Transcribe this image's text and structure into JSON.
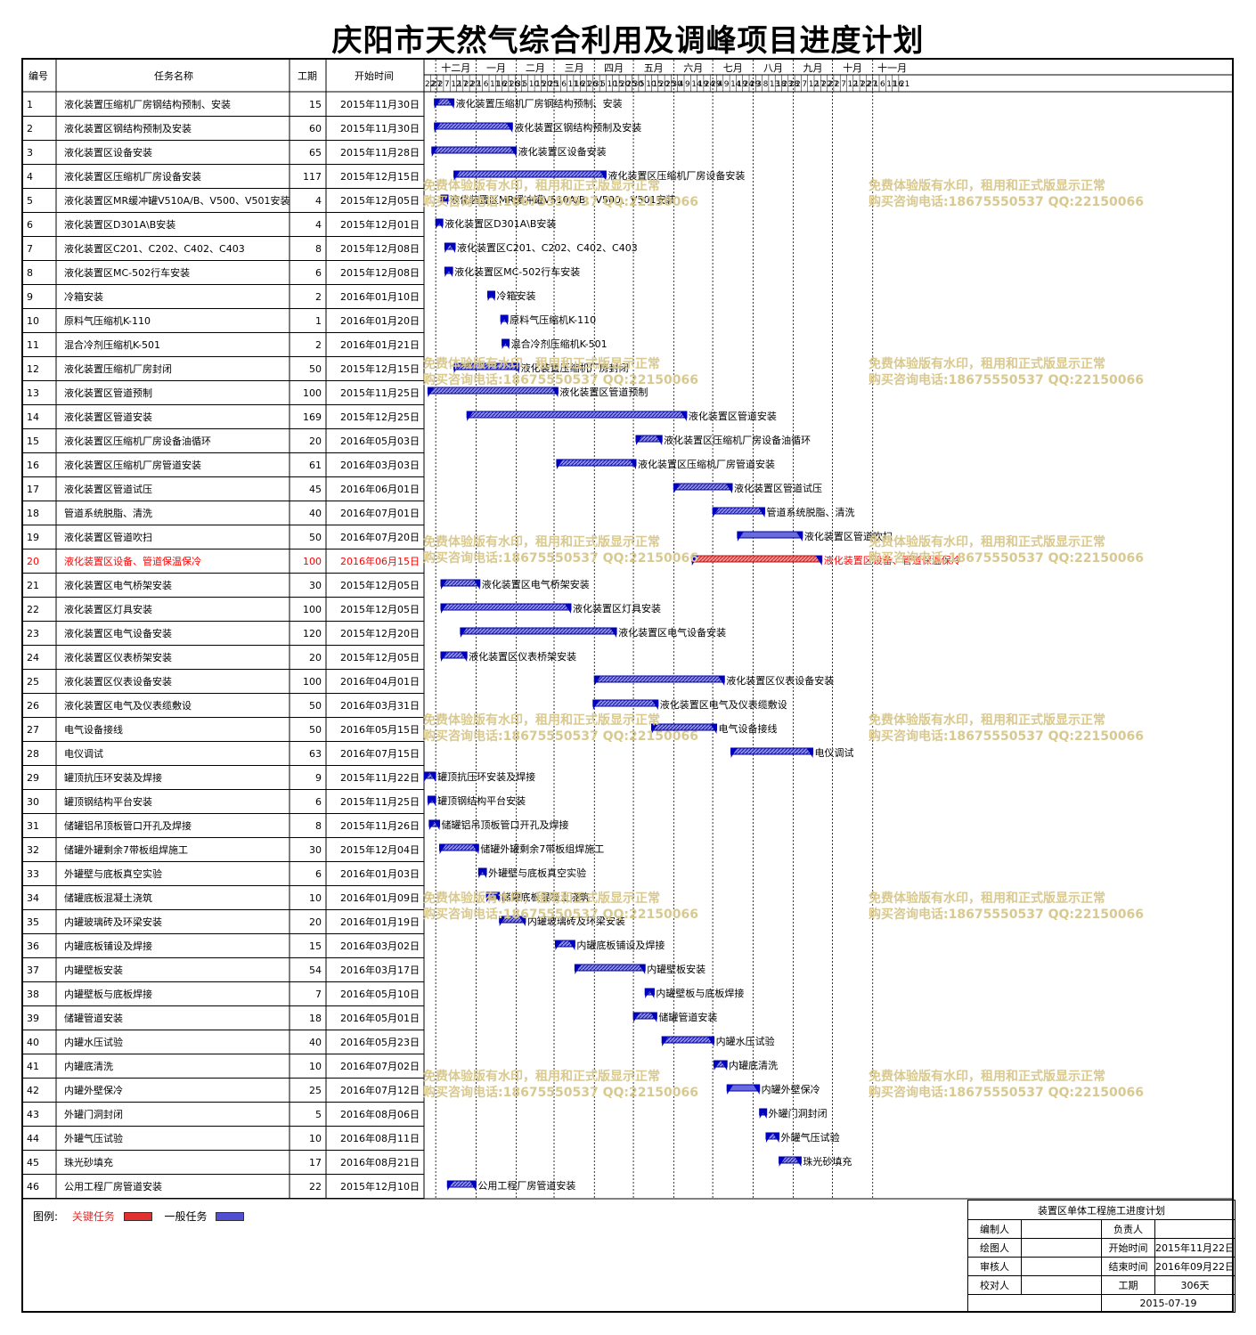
{
  "title": "庆阳市天然气综合利用及调峰项目进度计划",
  "headers": {
    "id": "编号",
    "name": "任务名称",
    "duration": "工期",
    "start": "开始时间"
  },
  "months": [
    "十二月",
    "一月",
    "二月",
    "三月",
    "四月",
    "五月",
    "六月",
    "七月",
    "八月",
    "九月",
    "十月",
    "十一月"
  ],
  "colors": {
    "critical": "#e03030",
    "normal": "#1010d0",
    "text_critical": "#ff0000"
  },
  "chart_data": {
    "type": "gantt",
    "timeline_start": "2015-11-22",
    "tasks": [
      {
        "id": "1",
        "name": "液化装置压缩机厂房钢结构预制、安装",
        "duration": 15,
        "start": "2015年11月30日",
        "start_date": "2015-11-30"
      },
      {
        "id": "2",
        "name": "液化装置区钢结构预制及安装",
        "duration": 60,
        "start": "2015年11月30日",
        "start_date": "2015-11-30"
      },
      {
        "id": "3",
        "name": "液化装置区设备安装",
        "duration": 65,
        "start": "2015年11月28日",
        "start_date": "2015-11-28"
      },
      {
        "id": "4",
        "name": "液化装置区压缩机厂房设备安装",
        "duration": 117,
        "start": "2015年12月15日",
        "start_date": "2015-12-15"
      },
      {
        "id": "5",
        "name": "液化装置区MR缓冲罐V510A/B、V500、V501安装",
        "duration": 4,
        "start": "2015年12月05日",
        "start_date": "2015-12-05"
      },
      {
        "id": "6",
        "name": "液化装置区D301A\\B安装",
        "duration": 4,
        "start": "2015年12月01日",
        "start_date": "2015-12-01"
      },
      {
        "id": "7",
        "name": "液化装置区C201、C202、C402、C403",
        "duration": 8,
        "start": "2015年12月08日",
        "start_date": "2015-12-08"
      },
      {
        "id": "8",
        "name": "液化装置区MC-502行车安装",
        "duration": 6,
        "start": "2015年12月08日",
        "start_date": "2015-12-08"
      },
      {
        "id": "9",
        "name": "冷箱安装",
        "duration": 2,
        "start": "2016年01月10日",
        "start_date": "2016-01-10"
      },
      {
        "id": "10",
        "name": "原料气压缩机K-110",
        "duration": 1,
        "start": "2016年01月20日",
        "start_date": "2016-01-20"
      },
      {
        "id": "11",
        "name": "混合冷剂压缩机K-501",
        "duration": 2,
        "start": "2016年01月21日",
        "start_date": "2016-01-21"
      },
      {
        "id": "12",
        "name": "液化装置压缩机厂房封闭",
        "duration": 50,
        "start": "2015年12月15日",
        "start_date": "2015-12-15"
      },
      {
        "id": "13",
        "name": "液化装置区管道预制",
        "duration": 100,
        "start": "2015年11月25日",
        "start_date": "2015-11-25"
      },
      {
        "id": "14",
        "name": "液化装置区管道安装",
        "duration": 169,
        "start": "2015年12月25日",
        "start_date": "2015-12-25"
      },
      {
        "id": "15",
        "name": "液化装置区压缩机厂房设备油循环",
        "duration": 20,
        "start": "2016年05月03日",
        "start_date": "2016-05-03"
      },
      {
        "id": "16",
        "name": "液化装置区压缩机厂房管道安装",
        "duration": 61,
        "start": "2016年03月03日",
        "start_date": "2016-03-03"
      },
      {
        "id": "17",
        "name": "液化装置区管道试压",
        "duration": 45,
        "start": "2016年06月01日",
        "start_date": "2016-06-01"
      },
      {
        "id": "18",
        "name": "管道系统脱脂、清洗",
        "duration": 40,
        "start": "2016年07月01日",
        "start_date": "2016-07-01"
      },
      {
        "id": "19",
        "name": "液化装置区管道吹扫",
        "duration": 50,
        "start": "2016年07月20日",
        "start_date": "2016-07-20",
        "style": "plain"
      },
      {
        "id": "20",
        "name": "液化装置区设备、管道保温保冷",
        "duration": 100,
        "start": "2016年06月15日",
        "start_date": "2016-06-15",
        "critical": true
      },
      {
        "id": "21",
        "name": "液化装置区电气桥架安装",
        "duration": 30,
        "start": "2015年12月05日",
        "start_date": "2015-12-05"
      },
      {
        "id": "22",
        "name": "液化装置区灯具安装",
        "duration": 100,
        "start": "2015年12月05日",
        "start_date": "2015-12-05"
      },
      {
        "id": "23",
        "name": "液化装置区电气设备安装",
        "duration": 120,
        "start": "2015年12月20日",
        "start_date": "2015-12-20"
      },
      {
        "id": "24",
        "name": "液化装置区仪表桥架安装",
        "duration": 20,
        "start": "2015年12月05日",
        "start_date": "2015-12-05"
      },
      {
        "id": "25",
        "name": "液化装置区仪表设备安装",
        "duration": 100,
        "start": "2016年04月01日",
        "start_date": "2016-04-01"
      },
      {
        "id": "26",
        "name": "液化装置区电气及仪表缆敷设",
        "duration": 50,
        "start": "2016年03月31日",
        "start_date": "2016-03-31"
      },
      {
        "id": "27",
        "name": "电气设备接线",
        "duration": 50,
        "start": "2016年05月15日",
        "start_date": "2016-05-15"
      },
      {
        "id": "28",
        "name": "电仪调试",
        "duration": 63,
        "start": "2016年07月15日",
        "start_date": "2016-07-15"
      },
      {
        "id": "29",
        "name": "罐顶抗压环安装及焊接",
        "duration": 9,
        "start": "2015年11月22日",
        "start_date": "2015-11-22"
      },
      {
        "id": "30",
        "name": "罐顶钢结构平台安装",
        "duration": 6,
        "start": "2015年11月25日",
        "start_date": "2015-11-25"
      },
      {
        "id": "31",
        "name": "储罐铝吊顶板管口开孔及焊接",
        "duration": 8,
        "start": "2015年11月26日",
        "start_date": "2015-11-26"
      },
      {
        "id": "32",
        "name": "储罐外罐剩余7带板组焊施工",
        "duration": 30,
        "start": "2015年12月04日",
        "start_date": "2015-12-04"
      },
      {
        "id": "33",
        "name": "外罐壁与底板真空实验",
        "duration": 6,
        "start": "2016年01月03日",
        "start_date": "2016-01-03"
      },
      {
        "id": "34",
        "name": "储罐底板混凝土浇筑",
        "duration": 10,
        "start": "2016年01月09日",
        "start_date": "2016-01-09"
      },
      {
        "id": "35",
        "name": "内罐玻璃砖及环梁安装",
        "duration": 20,
        "start": "2016年01月19日",
        "start_date": "2016-01-19"
      },
      {
        "id": "36",
        "name": "内罐底板铺设及焊接",
        "duration": 15,
        "start": "2016年03月02日",
        "start_date": "2016-03-02"
      },
      {
        "id": "37",
        "name": "内罐壁板安装",
        "duration": 54,
        "start": "2016年03月17日",
        "start_date": "2016-03-17"
      },
      {
        "id": "38",
        "name": "内罐壁板与底板焊接",
        "duration": 7,
        "start": "2016年05月10日",
        "start_date": "2016-05-10"
      },
      {
        "id": "39",
        "name": "储罐管道安装",
        "duration": 18,
        "start": "2016年05月01日",
        "start_date": "2016-05-01"
      },
      {
        "id": "40",
        "name": "内罐水压试验",
        "duration": 40,
        "start": "2016年05月23日",
        "start_date": "2016-05-23"
      },
      {
        "id": "41",
        "name": "内罐底清洗",
        "duration": 10,
        "start": "2016年07月02日",
        "start_date": "2016-07-02"
      },
      {
        "id": "42",
        "name": "内罐外壁保冷",
        "duration": 25,
        "start": "2016年07月12日",
        "start_date": "2016-07-12",
        "style": "plain"
      },
      {
        "id": "43",
        "name": "外罐门洞封闭",
        "duration": 5,
        "start": "2016年08月06日",
        "start_date": "2016-08-06"
      },
      {
        "id": "44",
        "name": "外罐气压试验",
        "duration": 10,
        "start": "2016年08月11日",
        "start_date": "2016-08-11"
      },
      {
        "id": "45",
        "name": "珠光砂填充",
        "duration": 17,
        "start": "2016年08月21日",
        "start_date": "2016-08-21"
      },
      {
        "id": "46",
        "name": "公用工程厂房管道安装",
        "duration": 22,
        "start": "2015年12月10日",
        "start_date": "2015-12-10"
      }
    ]
  },
  "legend": {
    "label": "图例:",
    "critical": "关键任务",
    "normal": "一般任务"
  },
  "title_block": {
    "heading": "装置区单体工程施工进度计划",
    "compiler_label": "编制人",
    "drawer_label": "绘图人",
    "reviewer_label": "审核人",
    "checker_label": "校对人",
    "owner_label": "负责人",
    "start_label": "开始时间",
    "start_value": "2015年11月22日",
    "end_label": "结束时间",
    "end_value": "2016年09月22日",
    "duration_label": "工期",
    "duration_value": "306天",
    "date": "2015-07-19"
  },
  "watermark": {
    "line1": "免费体验版有水印，租用和正式版显示正常",
    "line2": "购买咨询电话:18675550537 QQ:22150066"
  }
}
